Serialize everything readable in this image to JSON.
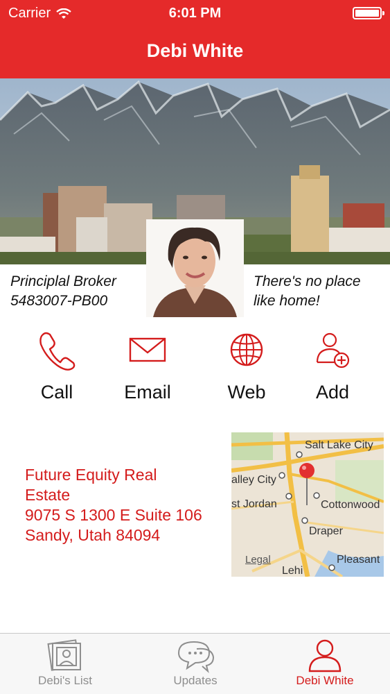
{
  "status_bar": {
    "carrier": "Carrier",
    "time": "6:01 PM"
  },
  "header": {
    "title": "Debi White"
  },
  "profile": {
    "role": "Principlal Broker",
    "license": "5483007-PB00",
    "tagline_line1": "There's no place",
    "tagline_line2": "like home!"
  },
  "actions": [
    {
      "label": "Call",
      "icon": "phone-icon"
    },
    {
      "label": "Email",
      "icon": "envelope-icon"
    },
    {
      "label": "Web",
      "icon": "globe-icon"
    },
    {
      "label": "Add",
      "icon": "add-contact-icon"
    }
  ],
  "address": {
    "line1": "Future Equity Real",
    "line2": "Estate",
    "line3": "9075 S 1300 E Suite 106",
    "line4": "Sandy, Utah 84094"
  },
  "map": {
    "labels": {
      "salt_lake_city": "Salt Lake City",
      "valley_city": "alley City",
      "west_jordan": "st Jordan",
      "cottonwood": "Cottonwood",
      "draper": "Draper",
      "pleasant": "Pleasant",
      "lehi": "Lehi"
    },
    "legal": "Legal"
  },
  "tabs": [
    {
      "label": "Debi's List",
      "icon": "photo-stack-icon",
      "active": false
    },
    {
      "label": "Updates",
      "icon": "chat-bubbles-icon",
      "active": false
    },
    {
      "label": "Debi White",
      "icon": "person-icon",
      "active": true
    }
  ],
  "colors": {
    "accent": "#e52a2a",
    "text_red": "#d41c1c"
  }
}
